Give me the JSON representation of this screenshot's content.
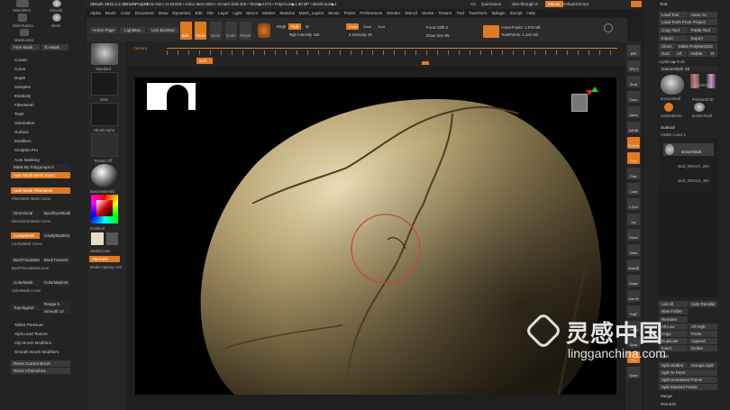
{
  "app": {
    "title": "ZBrush 2021.1.2 ZBrushProject",
    "status": "• Free Mem 10.834GB • Active Mem 5564 • Scratch Disk 508 • Timer▶0.073 • PolyCount▶1.98 MP • MeshCount▶1",
    "ac": "AC",
    "quicksave": "QuickSave",
    "seethrough": "See-through 0",
    "menus_label": "Menus",
    "defaultzscript": "DefaultZScript"
  },
  "menubar": [
    "Alpha",
    "Brush",
    "Color",
    "Document",
    "Draw",
    "Dynamics",
    "Edit",
    "File",
    "Layer",
    "Light",
    "Macro",
    "Marker",
    "Material",
    "Mesh_Layers",
    "Movie",
    "Picker",
    "Preferences",
    "Render",
    "Stencil",
    "Stroke",
    "Texture",
    "Tool",
    "Transform",
    "Zplugin",
    "Zscript",
    "Help"
  ],
  "left_top": {
    "select_rect": "SelectRect",
    "smooth": "Smooth",
    "select_lasso": "SelectLasso",
    "move": "Move",
    "mask_lasso": "MaskLasso",
    "freemask": "Free Mask",
    "tomask": "To Mask"
  },
  "left_menu": [
    "Create",
    "Curve",
    "Depth",
    "Samples",
    "Elasticity",
    "FiberMesh",
    "Twist",
    "Orientation",
    "Surface",
    "Modifiers",
    "Sculptris Pro"
  ],
  "automasking": {
    "title": "Auto Masking",
    "mask_by_polygroups": "Mask By Polygroups 0",
    "auto_mask_mesh_insert": "Auto Mask Mesh Insert",
    "auto_mask_fibermesh": "Auto Mask FiberMesh",
    "fibermesh_mask_curve": "FiberMesh Mask Curve",
    "directional": "Directional",
    "backfacemask": "BackfaceMask",
    "directional_curve": "Directional Mask Curve",
    "cavitymask": "CavityMask",
    "cavitymask_int": "CavityMaskInt",
    "cavitymask_curve": "CavityMask Curve",
    "backtracemask": "BackTraceMask",
    "backtrace_int": "BackTraceInt",
    "backtrace_curve": "BackTraceMaskCurve",
    "colormask": "ColorMask",
    "colormask_int": "ColorMaskInt",
    "colormask_curve": "ColorMask Curve",
    "topological": "Topological",
    "range": "Range 5",
    "smooth": "Smooth 10"
  },
  "left_bottom": [
    "Tablet Pressure",
    "Alpha and Texture",
    "Clip Brush Modifiers",
    "Smooth Brush Modifiers"
  ],
  "reset": {
    "current": "Reset Current Brush",
    "all": "Reset All Brushes"
  },
  "tray": {
    "standard": "Standard",
    "dots": "Dots",
    "alpha": "~BrushAlpha",
    "texture_off": "Texture Off",
    "basic_material": "BasicMaterial2",
    "gradient": "Gradient",
    "switch_color": "SwitchColor",
    "alternate": "Alternate",
    "model_opacity": "Model Opacity 100"
  },
  "toolbar": {
    "home_page": "Home Page",
    "lightbox": "LightBox",
    "live_boolean": "Live Boolean",
    "edit": "Edit",
    "draw": "Draw",
    "move": "Move",
    "scale": "Scale",
    "rotate": "Rotate",
    "mrgb": "Mrgb",
    "rgb": "Rgb",
    "m": "M",
    "zadd": "Zadd",
    "zsub": "Zsub",
    "zcut": "Zcut",
    "rgb_intensity": "Rgb Intensity 100",
    "z_intensity": "Z Intensity 25",
    "focal_shift": "Focal Shift 0",
    "draw_size": "Draw Size 85",
    "dynamic": "Dynamic",
    "active_points": "ActivePoints: 1.979 Mil",
    "total_points": "TotalPoints: 1.341 Mil"
  },
  "timeline": {
    "camera": "Camera",
    "frame": "0001"
  },
  "right_strip": [
    "BPR",
    "SPix 3",
    "Scroll",
    "Zoom",
    "Actual",
    "AAHalf",
    "Dynamic",
    "Persp",
    "Floor",
    "Local",
    "L.Sym",
    "Xyz",
    "Frame",
    "Move",
    "Zoom3D",
    "Rotate",
    "Line Fill",
    "PolyF",
    "Transp",
    "Ghost",
    "Solo",
    "Xpose"
  ],
  "tool_panel": {
    "title": "Tool",
    "load_tool": "Load Tool",
    "save_as": "Save As",
    "load_from_project": "Load Tools From Project",
    "copy_tool": "Copy Tool",
    "paste_tool": "Paste Tool",
    "import": "Import",
    "export": "Export",
    "clone": "Clone",
    "make_polymesh": "Make PolyMesh3D",
    "goz": "GoZ",
    "all": "All",
    "visible": "Visible",
    "r": "R",
    "lightbox_tools": "Lightbox▶Tools",
    "texture_skull": "textureSkull. 48",
    "tool_labels": [
      "textureSkull",
      "Cylinder3D",
      "PolyMesh3D",
      "SimpleBrush",
      "textureSkull"
    ],
    "subtool": "Subtool",
    "visible_count": "Visible Count 1",
    "subtools": [
      "textureSkull",
      "skull_REDUX_250",
      "skull_REDUX_450"
    ],
    "list_all": "List All",
    "auto_reorder": "Auto Reorder",
    "new_folder": "New Folder",
    "rename": "Rename",
    "all_low": "All Low",
    "all_high": "All High",
    "copy": "Copy",
    "paste": "Paste",
    "duplicate": "Duplicate",
    "append": "Append",
    "insert": "Insert",
    "delete": "Delete",
    "del_other": "Del Other",
    "del_all": "Del All",
    "split": "Split",
    "split_hidden": "Split Hidden",
    "groups_split": "Groups Split",
    "split_to_parts": "Split To Parts",
    "split_unmasked": "Split Unmasked Points",
    "split_masked": "Split Masked Points",
    "merge": "Merge",
    "remesh": "Remesh"
  },
  "watermark": {
    "brand": "灵感中国",
    "url": "lingganchina.com"
  }
}
